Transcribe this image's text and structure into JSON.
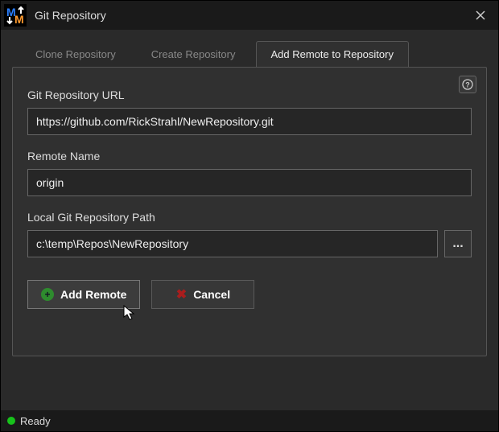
{
  "window": {
    "title": "Git Repository"
  },
  "tabs": {
    "clone": "Clone Repository",
    "create": "Create Repository",
    "addremote": "Add Remote to Repository"
  },
  "form": {
    "url_label": "Git Repository URL",
    "url_value": "https://github.com/RickStrahl/NewRepository.git",
    "remote_label": "Remote Name",
    "remote_value": "origin",
    "path_label": "Local Git Repository Path",
    "path_value": "c:\\temp\\Repos\\NewRepository",
    "browse_label": "...",
    "add_button": "Add Remote",
    "cancel_button": "Cancel"
  },
  "status": {
    "text": "Ready"
  }
}
